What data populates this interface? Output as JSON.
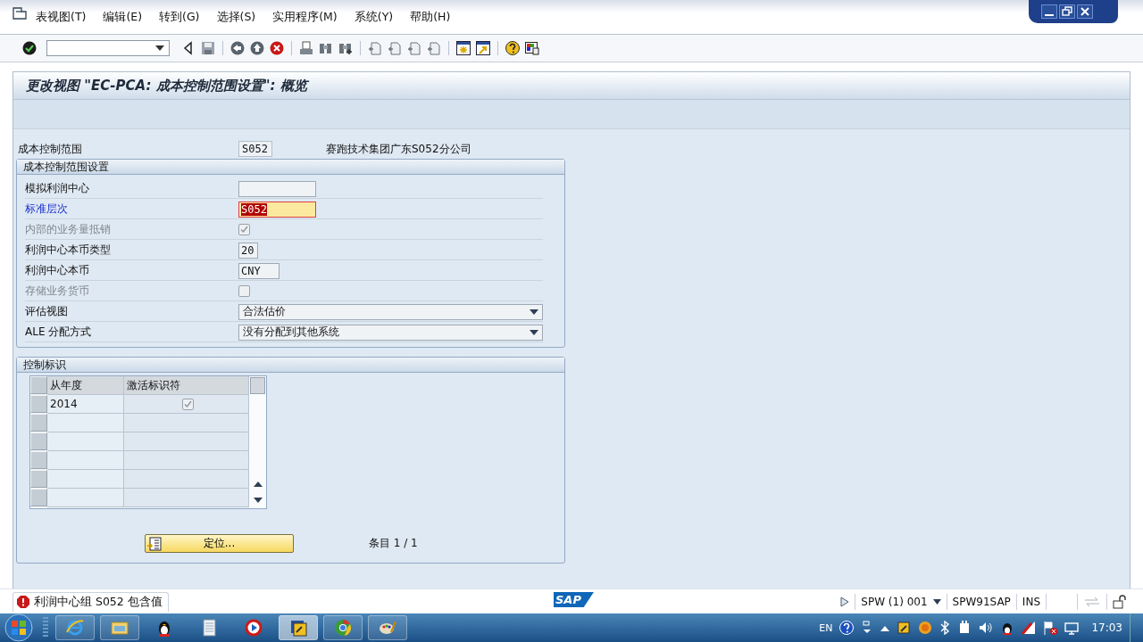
{
  "menu": [
    "表视图(T)",
    "编辑(E)",
    "转到(G)",
    "选择(S)",
    "实用程序(M)",
    "系统(Y)",
    "帮助(H)"
  ],
  "title": "更改视图 \"EC-PCA: 成本控制范围设置\": 概览",
  "header": {
    "label": "成本控制范围",
    "value": "S052",
    "description": "赛跑技术集团广东S052分公司"
  },
  "settings": {
    "title": "成本控制范围设置",
    "fields": [
      {
        "kind": "input",
        "label": "模拟利润中心",
        "focused": false
      },
      {
        "kind": "input",
        "label": "标准层次",
        "value": "S052",
        "focused": true
      },
      {
        "kind": "checkbox",
        "label": "内部的业务量抵销",
        "checked": true,
        "disabled": true
      },
      {
        "kind": "input",
        "label": "利润中心本币类型",
        "value": "20",
        "focused": false
      },
      {
        "kind": "input",
        "label": "利润中心本币",
        "value": "CNY",
        "focused": false
      },
      {
        "kind": "checkbox",
        "label": "存储业务货币",
        "checked": false,
        "disabled": true
      },
      {
        "kind": "dropdown",
        "label": "评估视图",
        "value": "合法估价"
      },
      {
        "kind": "dropdown",
        "label": "ALE 分配方式",
        "value": "没有分配到其他系统"
      }
    ]
  },
  "control": {
    "title": "控制标识",
    "table": {
      "columns": [
        "从年度",
        "激活标识符"
      ],
      "rows": [
        {
          "from_year": "2014",
          "active": true
        }
      ]
    },
    "position_button": "定位...",
    "entry_count": "条目 1 / 1"
  },
  "status_bar": {
    "message": {
      "kind": "error",
      "text": "利润中心组 S052 包含值"
    },
    "logo": "SAP",
    "system": "SPW (1) 001",
    "server": "SPW91SAP",
    "mode": "INS"
  },
  "taskbar": {
    "language": "EN",
    "clock": "17:03"
  }
}
